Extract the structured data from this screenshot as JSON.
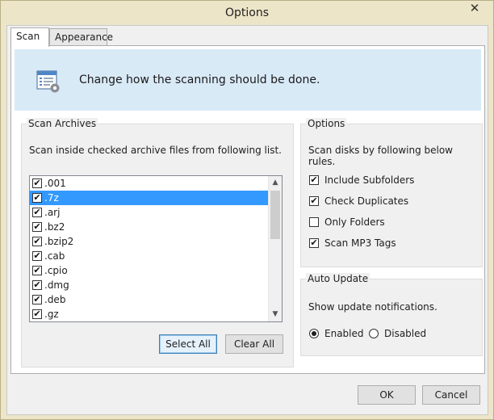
{
  "window": {
    "title": "Options",
    "close_glyph": "✕"
  },
  "tabs": [
    {
      "label": "Scan",
      "active": true
    },
    {
      "label": "Appearance",
      "active": false
    }
  ],
  "banner": {
    "text": "Change how the scanning should be done.",
    "icon": "settings-list-icon"
  },
  "scan_archives": {
    "title": "Scan Archives",
    "description": "Scan inside checked archive files from following list.",
    "items": [
      {
        "label": ".001",
        "checked": true,
        "selected": false
      },
      {
        "label": ".7z",
        "checked": true,
        "selected": true
      },
      {
        "label": ".arj",
        "checked": true,
        "selected": false
      },
      {
        "label": ".bz2",
        "checked": true,
        "selected": false
      },
      {
        "label": ".bzip2",
        "checked": true,
        "selected": false
      },
      {
        "label": ".cab",
        "checked": true,
        "selected": false
      },
      {
        "label": ".cpio",
        "checked": true,
        "selected": false
      },
      {
        "label": ".dmg",
        "checked": true,
        "selected": false
      },
      {
        "label": ".deb",
        "checked": true,
        "selected": false
      },
      {
        "label": ".gz",
        "checked": true,
        "selected": false
      }
    ],
    "select_all_label": "Select All",
    "clear_all_label": "Clear All"
  },
  "options": {
    "title": "Options",
    "description": "Scan disks by following below rules.",
    "items": [
      {
        "label": "Include Subfolders",
        "checked": true
      },
      {
        "label": "Check Duplicates",
        "checked": true
      },
      {
        "label": "Only Folders",
        "checked": false
      },
      {
        "label": "Scan MP3 Tags",
        "checked": true
      }
    ]
  },
  "auto_update": {
    "title": "Auto Update",
    "description": "Show update notifications.",
    "enabled_label": "Enabled",
    "disabled_label": "Disabled",
    "value": "Enabled"
  },
  "footer": {
    "ok_label": "OK",
    "cancel_label": "Cancel"
  },
  "colors": {
    "selection": "#3399ff",
    "banner_bg": "#d9eaf7",
    "frame": "#ece5c8"
  }
}
